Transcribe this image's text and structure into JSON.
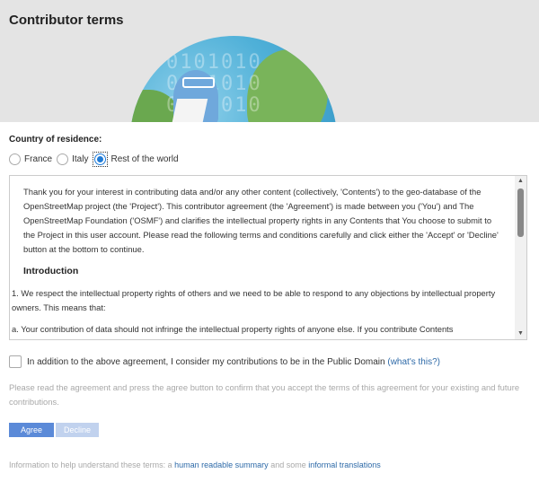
{
  "header": {
    "title": "Contributor terms"
  },
  "country": {
    "label": "Country of residence:",
    "options": [
      "France",
      "Italy",
      "Rest of the world"
    ],
    "selected": "Rest of the world"
  },
  "terms": {
    "intro": "Thank you for your interest in contributing data and/or any other content (collectively, 'Contents') to the geo-database of the OpenStreetMap project (the 'Project'). This contributor agreement (the 'Agreement') is made between you ('You') and The OpenStreetMap Foundation ('OSMF') and clarifies the intellectual property rights in any Contents that You choose to submit to the Project in this user account. Please read the following terms and conditions carefully and click either the 'Accept' or 'Decline' button at the bottom to continue.",
    "heading": "Introduction",
    "item1": "1. We respect the intellectual property rights of others and we need to be able to respond to any objections by intellectual property owners. This means that:",
    "item_a": "a. Your contribution of data should not infringe the intellectual property rights of anyone else. If you contribute Contents"
  },
  "public_domain": {
    "label": "In addition to the above agreement, I consider my contributions to be in the Public Domain",
    "link_open": "(",
    "link": "what's this?",
    "link_close": ")"
  },
  "instructions": "Please read the agreement and press the agree button to confirm that you accept the terms of this agreement for your existing and future contributions.",
  "buttons": {
    "agree": "Agree",
    "decline": "Decline"
  },
  "info": {
    "prefix": "Information to help understand these terms: a",
    "summary_link": "human readable summary",
    "middle": "and some",
    "translations_link": "informal translations"
  },
  "colors": {
    "link": "#2e6aa8",
    "agree_button": "#5b8ad8",
    "decline_button": "#c1d2ee",
    "radio_selected": "#1f7ad6"
  }
}
